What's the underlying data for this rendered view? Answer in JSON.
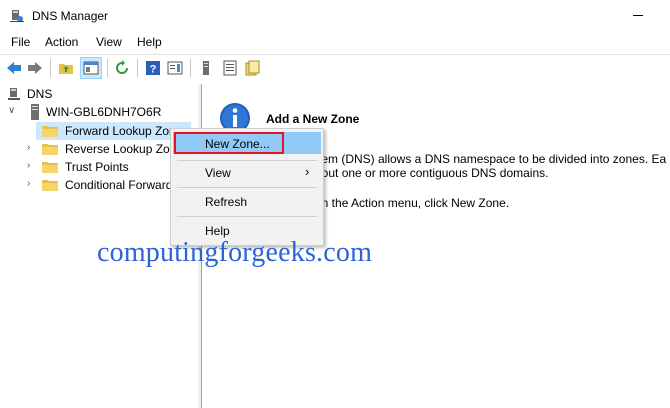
{
  "window": {
    "title": "DNS Manager"
  },
  "menubar": {
    "items": [
      "File",
      "Action",
      "View",
      "Help"
    ]
  },
  "tree": {
    "root": "DNS",
    "server": "WIN-GBL6DNH7O6R",
    "children": [
      "Forward Lookup Zones",
      "Reverse Lookup Zones",
      "Trust Points",
      "Conditional Forwarders"
    ]
  },
  "detail": {
    "heading": "Add a New Zone",
    "line1": "System (DNS) allows a DNS namespace to be divided into zones. Ea",
    "line2": "bout one or more contiguous DNS domains.",
    "line3": "on the Action menu, click New Zone."
  },
  "context_menu": {
    "items": [
      "New Zone...",
      "View",
      "Refresh",
      "Help"
    ],
    "selected": "New Zone..."
  },
  "watermark": "computingforgeeks.com",
  "colors": {
    "accent": "#0078d7",
    "highlight": "#cce8ff",
    "selection_border": "#e81123",
    "watermark": "#2b63d8"
  }
}
